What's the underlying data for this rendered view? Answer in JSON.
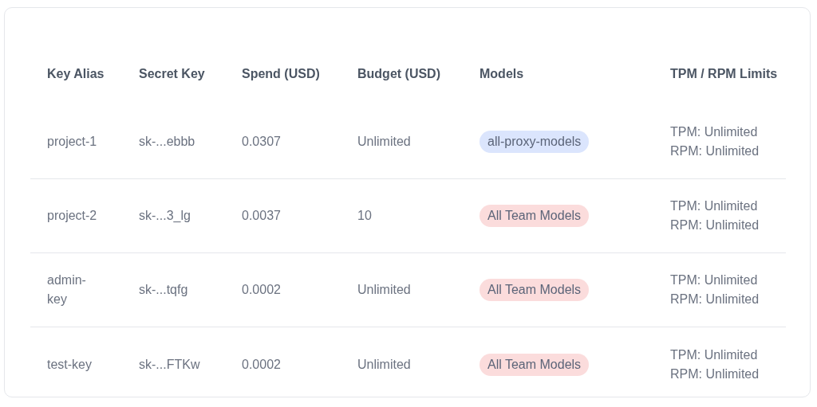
{
  "table": {
    "columns": [
      "Key Alias",
      "Secret Key",
      "Spend (USD)",
      "Budget (USD)",
      "Models",
      "TPM / RPM Limits"
    ],
    "rows": [
      {
        "key_alias": "project-1",
        "secret_key": "sk-...ebbb",
        "spend": "0.0307",
        "budget": "Unlimited",
        "models": {
          "label": "all-proxy-models",
          "color": "#dbe5fd"
        },
        "tpm": "TPM: Unlimited",
        "rpm": "RPM: Unlimited"
      },
      {
        "key_alias": "project-2",
        "secret_key": "sk-...3_lg",
        "spend": "0.0037",
        "budget": "10",
        "models": {
          "label": "All Team Models",
          "color": "#fbdcdc"
        },
        "tpm": "TPM: Unlimited",
        "rpm": "RPM: Unlimited"
      },
      {
        "key_alias": "admin-key",
        "secret_key": "sk-...tqfg",
        "spend": "0.0002",
        "budget": "Unlimited",
        "models": {
          "label": "All Team Models",
          "color": "#fbdcdc"
        },
        "tpm": "TPM: Unlimited",
        "rpm": "RPM: Unlimited"
      },
      {
        "key_alias": "test-key",
        "secret_key": "sk-...FTKw",
        "spend": "0.0002",
        "budget": "Unlimited",
        "models": {
          "label": "All Team Models",
          "color": "#fbdcdc"
        },
        "tpm": "TPM: Unlimited",
        "rpm": "RPM: Unlimited"
      }
    ]
  }
}
